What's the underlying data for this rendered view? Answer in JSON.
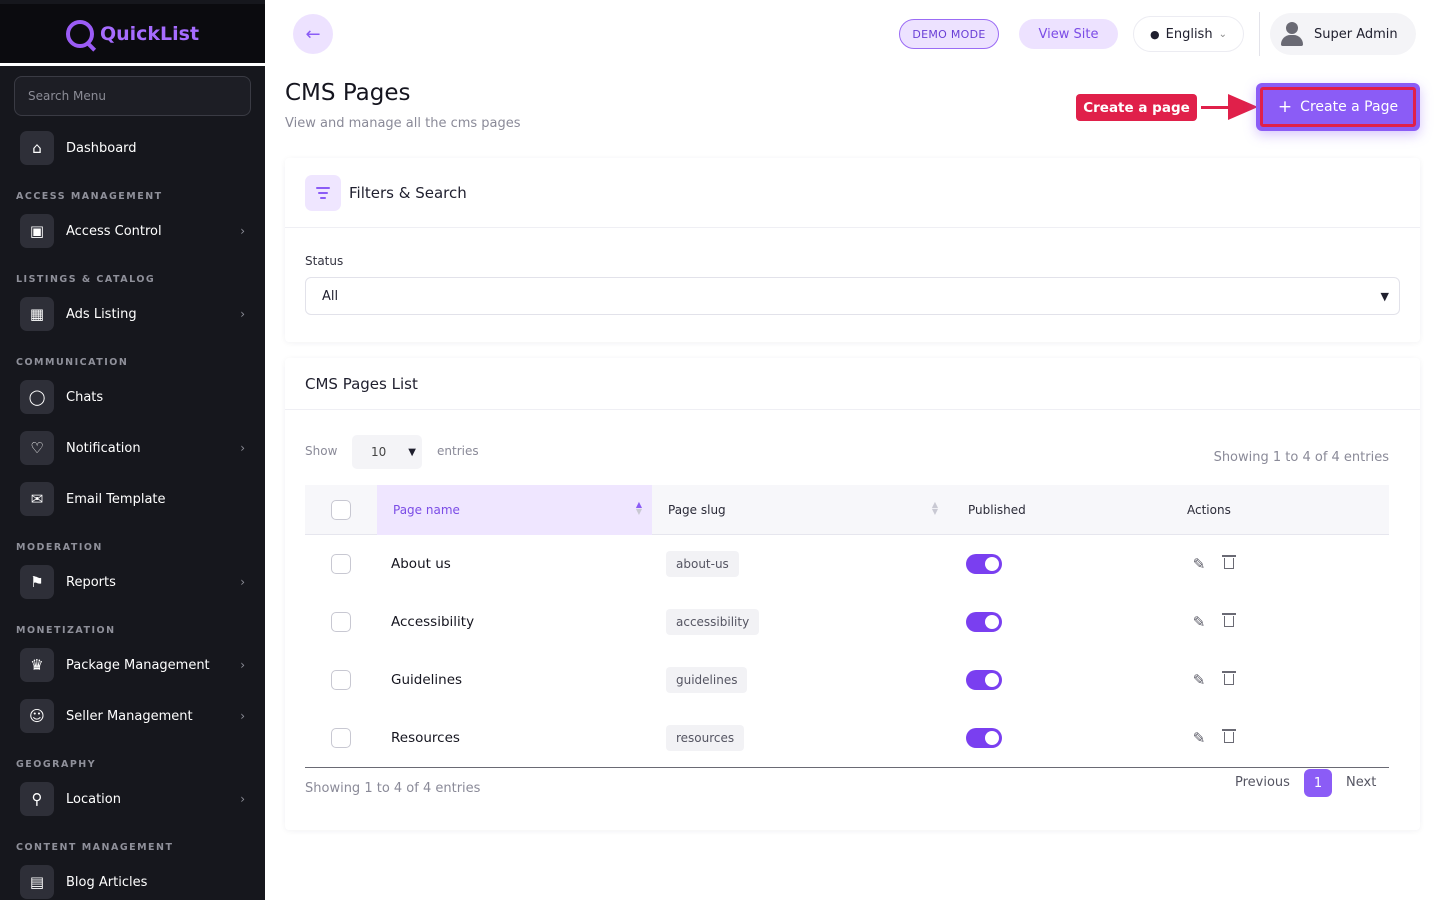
{
  "app": {
    "logo_text": "QuickList",
    "brand_color": "#8b5cf6"
  },
  "sidebar": {
    "search_placeholder": "Search Menu",
    "sections": {
      "access": "ACCESS MANAGEMENT",
      "listings": "LISTINGS & CATALOG",
      "communication": "COMMUNICATION",
      "moderation": "MODERATION",
      "monetization": "MONETIZATION",
      "geography": "GEOGRAPHY",
      "content": "CONTENT MANAGEMENT"
    },
    "items": {
      "dashboard": "Dashboard",
      "access_control": "Access Control",
      "ads_listing": "Ads Listing",
      "chats": "Chats",
      "notification": "Notification",
      "email_template": "Email Template",
      "reports": "Reports",
      "package_management": "Package Management",
      "seller_management": "Seller Management",
      "location": "Location",
      "blog_articles": "Blog Articles"
    }
  },
  "topbar": {
    "demo_mode": "DEMO MODE",
    "view_site": "View Site",
    "language": "English",
    "user": "Super Admin"
  },
  "page": {
    "title": "CMS Pages",
    "subtitle": "View and manage all the cms pages",
    "annotation": "Create a page",
    "create_button": "Create a Page"
  },
  "filters": {
    "title": "Filters & Search",
    "status_label": "Status",
    "status_value": "All"
  },
  "list": {
    "title": "CMS Pages List",
    "show_label": "Show",
    "entries_value": "10",
    "entries_label": "entries",
    "showing_text": "Showing 1 to 4 of 4 entries",
    "columns": {
      "name": "Page name",
      "slug": "Page slug",
      "published": "Published",
      "actions": "Actions"
    },
    "rows": [
      {
        "name": "About us",
        "slug": "about-us",
        "published": true
      },
      {
        "name": "Accessibility",
        "slug": "accessibility",
        "published": true
      },
      {
        "name": "Guidelines",
        "slug": "guidelines",
        "published": true
      },
      {
        "name": "Resources",
        "slug": "resources",
        "published": true
      }
    ],
    "pagination": {
      "previous": "Previous",
      "current": "1",
      "next": "Next"
    }
  }
}
